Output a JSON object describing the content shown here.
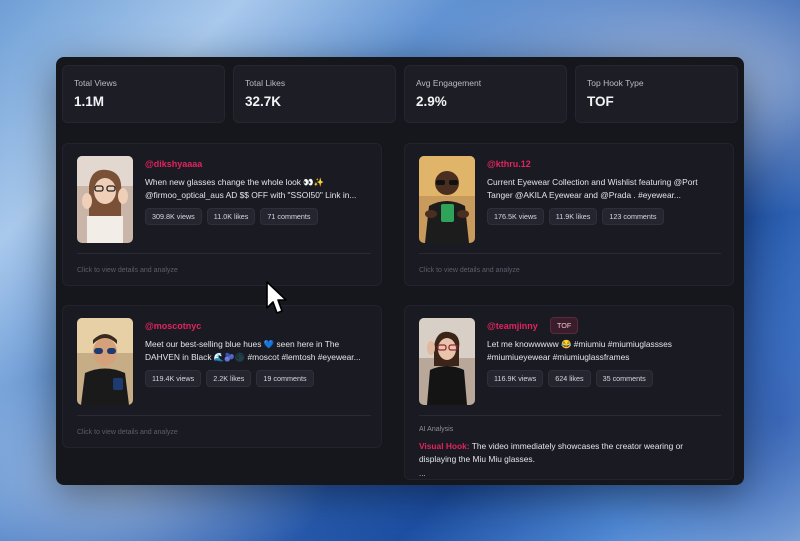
{
  "stats": [
    {
      "label": "Total Views",
      "value": "1.1M"
    },
    {
      "label": "Total Likes",
      "value": "32.7K"
    },
    {
      "label": "Avg Engagement",
      "value": "2.9%"
    },
    {
      "label": "Top Hook Type",
      "value": "TOF"
    }
  ],
  "posts": [
    {
      "handle": "@dikshyaaaa",
      "caption_line1": "When new glasses change the whole look 👀✨",
      "caption_line2": "@firmoo_optical_aus AD $$ OFF with \"SSOI50\" Link in...",
      "views": "309.8K views",
      "likes": "11.0K likes",
      "comments": "71 comments",
      "hint": "Click to view details and analyze"
    },
    {
      "handle": "@kthru.12",
      "caption_line1": "Current Eyewear Collection and Wishlist featuring @Port",
      "caption_line2": "Tanger @AKILA Eyewear and @Prada . #eyewear...",
      "views": "176.5K views",
      "likes": "11.9K likes",
      "comments": "123 comments",
      "hint": "Click to view details and analyze"
    },
    {
      "handle": "@moscotnyc",
      "caption_line1": "Meet our best-selling blue hues 💙 seen here in The",
      "caption_line2": "DAHVEN in Black 🌊🫐🌑 #moscot #lemtosh #eyewear...",
      "views": "119.4K views",
      "likes": "2.2K likes",
      "comments": "19 comments",
      "hint": "Click to view details and analyze"
    },
    {
      "handle": "@teamjinny",
      "badge": "TOF",
      "caption_line1": "Let me knowwwww 😂 #miumiu #miumiuglassses",
      "caption_line2": "#miumiueyewear #miumiuglassframes",
      "views": "116.9K views",
      "likes": "624 likes",
      "comments": "35 comments",
      "ai_label": "AI Analysis",
      "ai_hook_label": "Visual Hook:",
      "ai_text": " The video immediately showcases the creator wearing or displaying the Miu Miu glasses.",
      "ai_ellipsis": "..."
    }
  ],
  "icons": {
    "cursor": "arrow-cursor-icon"
  },
  "colors": {
    "accent": "#e0245e",
    "panel": "#16161d",
    "card": "#1a1a22"
  }
}
